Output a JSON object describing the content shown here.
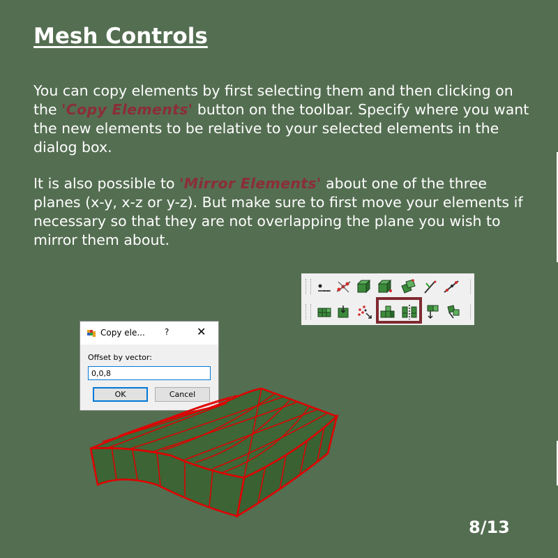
{
  "slide": {
    "title": "Mesh Controls",
    "paragraph1": {
      "before": "You can copy elements by first selecting them and then clicking on the ",
      "highlight": "'Copy Elements'",
      "after": " button on the toolbar. Specify where you want the new elements to be relative to your selected elements in the dialog box."
    },
    "paragraph2": {
      "before": "It is also possible to ",
      "highlight": "'Mirror Elements'",
      "after": " about one of the three planes (x-y, x-z or y-z). But make sure to first move your elements if necessary so that they are not overlapping the plane you wish to mirror them about."
    },
    "page_number": "8/13"
  },
  "toolbar": {
    "row1_icons": [
      "node-input-icon",
      "node-chain-icon",
      "cube-element-icon",
      "cube-select-icon",
      "cube-rotate-icon",
      "axis-icon",
      "line-nodes-icon"
    ],
    "row2_icons": [
      "element-grid-icon",
      "element-move-icon",
      "scatter-nodes-icon",
      "copy-elements-icon",
      "mirror-elements-icon",
      "element-arrow-down-icon",
      "element-rotate-icon"
    ],
    "highlighted": [
      "copy-elements-icon",
      "mirror-elements-icon"
    ]
  },
  "dialog": {
    "title": "Copy ele...",
    "help_label": "?",
    "close_label": "✕",
    "field_label": "Offset by vector:",
    "field_value": "0,0,8",
    "ok_label": "OK",
    "cancel_label": "Cancel"
  },
  "colors": {
    "background": "#546e51",
    "highlight_text": "#8b2e36",
    "mesh_fill": "#3e6636",
    "mesh_edge": "#e00000",
    "toolbar_highlight": "#7f2a30"
  }
}
